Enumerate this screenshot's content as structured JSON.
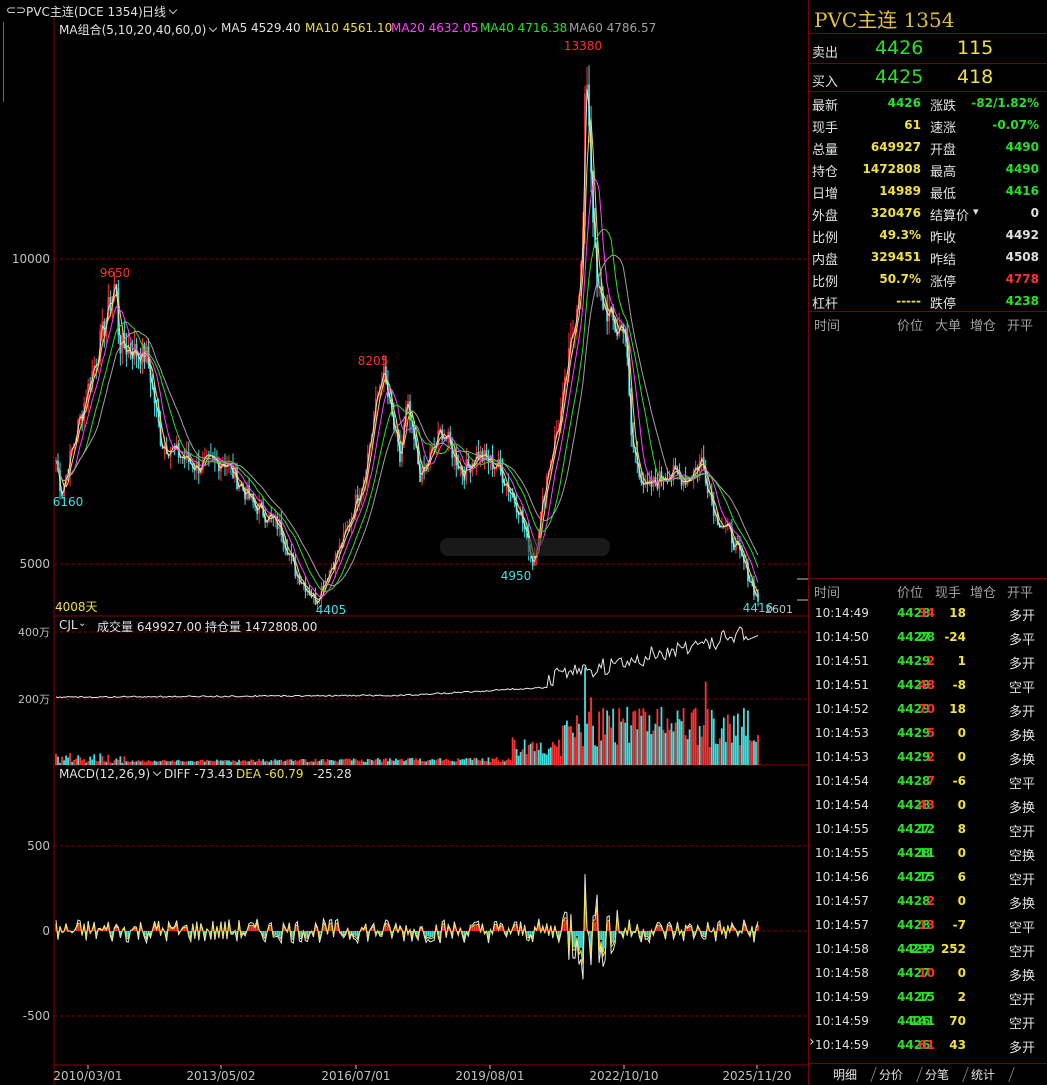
{
  "toolbar": {
    "symbol": "PVC主连(DCE 1354)",
    "period": "日线"
  },
  "main_chart": {
    "ma_group": "MA组合(5,10,20,40,60,0)",
    "ma5": "MA5 4529.40",
    "ma10": "MA10 4561.10",
    "ma20": "MA20 4632.05",
    "ma40": "MA40 4716.38",
    "ma60": "MA60 4786.57",
    "y_ticks": [
      "10000",
      "5000"
    ],
    "annotations": [
      "13380",
      "9650",
      "8205",
      "6160",
      "4950",
      "4405",
      "4416"
    ],
    "days_label": "4008天",
    "partial_label": "2601"
  },
  "volume_chart": {
    "title": "CJL",
    "volume_text": "成交量 649927.00",
    "oi_text": "持仓量 1472808.00",
    "y_ticks": [
      "400万",
      "200万"
    ]
  },
  "macd_chart": {
    "title": "MACD(12,26,9)",
    "diff": "DIFF -73.43",
    "dea": "DEA -60.79",
    "macd": "-25.28",
    "y_ticks": [
      "500",
      "0",
      "-500"
    ]
  },
  "x_axis": [
    "2010/03/01",
    "2013/05/02",
    "2016/07/01",
    "2019/08/01",
    "2022/10/10",
    "2025/11/20"
  ],
  "panel": {
    "title": "PVC主连 1354",
    "sell": {
      "label": "卖出",
      "price": "4426",
      "vol": "115"
    },
    "buy": {
      "label": "买入",
      "price": "4425",
      "vol": "418"
    },
    "stats_left": [
      {
        "k": "最新",
        "v": "4426",
        "c": "#28e028"
      },
      {
        "k": "现手",
        "v": "61",
        "c": "#f0e040"
      },
      {
        "k": "总量",
        "v": "649927",
        "c": "#f0e040"
      },
      {
        "k": "持仓",
        "v": "1472808",
        "c": "#f0e040"
      },
      {
        "k": "日增",
        "v": "14989",
        "c": "#f0e040"
      },
      {
        "k": "外盘",
        "v": "320476",
        "c": "#f0e040"
      },
      {
        "k": "比例",
        "v": "49.3%",
        "c": "#f0e040"
      },
      {
        "k": "内盘",
        "v": "329451",
        "c": "#f0e040"
      },
      {
        "k": "比例",
        "v": "50.7%",
        "c": "#f0e040"
      },
      {
        "k": "杠杆",
        "v": "-----",
        "c": "#f0e040"
      }
    ],
    "stats_right": [
      {
        "k": "涨跌",
        "v": "-82/1.82%",
        "c": "#28e028"
      },
      {
        "k": "速涨",
        "v": "-0.07%",
        "c": "#28e028"
      },
      {
        "k": "开盘",
        "v": "4490",
        "c": "#28e028"
      },
      {
        "k": "最高",
        "v": "4490",
        "c": "#28e028"
      },
      {
        "k": "最低",
        "v": "4416",
        "c": "#28e028"
      },
      {
        "k": "结算价",
        "v": "0",
        "c": "#e0e0e0"
      },
      {
        "k": "昨收",
        "v": "4492",
        "c": "#e0e0e0"
      },
      {
        "k": "昨结",
        "v": "4508",
        "c": "#e0e0e0"
      },
      {
        "k": "涨停",
        "v": "4778",
        "c": "#ff3030"
      },
      {
        "k": "跌停",
        "v": "4238",
        "c": "#28e028"
      }
    ],
    "big_order_head": [
      "时间",
      "价位",
      "大单",
      "增仓",
      "开平"
    ],
    "tick_head": [
      "时间",
      "价位",
      "现手",
      "增仓",
      "开平"
    ],
    "ticks": [
      {
        "t": "10:14:49",
        "p": "4428",
        "q": "34",
        "qc": "#ff3030",
        "z": "18",
        "k": "多开"
      },
      {
        "t": "10:14:50",
        "p": "4427",
        "q": "28",
        "qc": "#28e028",
        "z": "-24",
        "k": "多平"
      },
      {
        "t": "10:14:51",
        "p": "4429",
        "q": "2",
        "qc": "#ff3030",
        "z": "1",
        "k": "多开"
      },
      {
        "t": "10:14:51",
        "p": "4429",
        "q": "48",
        "qc": "#ff3030",
        "z": "-8",
        "k": "空平"
      },
      {
        "t": "10:14:52",
        "p": "4429",
        "q": "70",
        "qc": "#ff3030",
        "z": "18",
        "k": "多开"
      },
      {
        "t": "10:14:53",
        "p": "4429",
        "q": "5",
        "qc": "#ff3030",
        "z": "0",
        "k": "多换"
      },
      {
        "t": "10:14:53",
        "p": "4429",
        "q": "2",
        "qc": "#ff3030",
        "z": "0",
        "k": "多换"
      },
      {
        "t": "10:14:54",
        "p": "4428",
        "q": "7",
        "qc": "#ff3030",
        "z": "-6",
        "k": "空平"
      },
      {
        "t": "10:14:54",
        "p": "4428",
        "q": "43",
        "qc": "#ff3030",
        "z": "0",
        "k": "多换"
      },
      {
        "t": "10:14:55",
        "p": "4427",
        "q": "12",
        "qc": "#28e028",
        "z": "8",
        "k": "空开"
      },
      {
        "t": "10:14:55",
        "p": "4428",
        "q": "11",
        "qc": "#28e028",
        "z": "0",
        "k": "空换"
      },
      {
        "t": "10:14:56",
        "p": "4427",
        "q": "15",
        "qc": "#28e028",
        "z": "6",
        "k": "空开"
      },
      {
        "t": "10:14:57",
        "p": "4428",
        "q": "2",
        "qc": "#ff3030",
        "z": "0",
        "k": "多换"
      },
      {
        "t": "10:14:57",
        "p": "4428",
        "q": "13",
        "qc": "#ff3030",
        "z": "-7",
        "k": "空平"
      },
      {
        "t": "10:14:58",
        "p": "4427",
        "q": "299",
        "qc": "#28e028",
        "z": "252",
        "k": "空开"
      },
      {
        "t": "10:14:58",
        "p": "4427",
        "q": "10",
        "qc": "#ff3030",
        "z": "0",
        "k": "多换"
      },
      {
        "t": "10:14:59",
        "p": "4427",
        "q": "15",
        "qc": "#28e028",
        "z": "2",
        "k": "空开"
      },
      {
        "t": "10:14:59",
        "p": "4426",
        "q": "141",
        "qc": "#28e028",
        "z": "70",
        "k": "空开"
      },
      {
        "t": "10:14:59",
        "p": "4426",
        "q": "61",
        "qc": "#ff3030",
        "z": "43",
        "k": "多开"
      }
    ],
    "tabs": [
      "明细",
      "分价",
      "分笔",
      "统计"
    ]
  },
  "colors": {
    "up": "#ff3030",
    "down": "#28e028",
    "cyan": "#40e0e0",
    "ma5": "#e0e0e0",
    "ma10": "#f0e040",
    "ma20": "#ff40ff",
    "ma40": "#28e028",
    "ma60": "#a0a0a0",
    "grid": "#8a0000"
  }
}
